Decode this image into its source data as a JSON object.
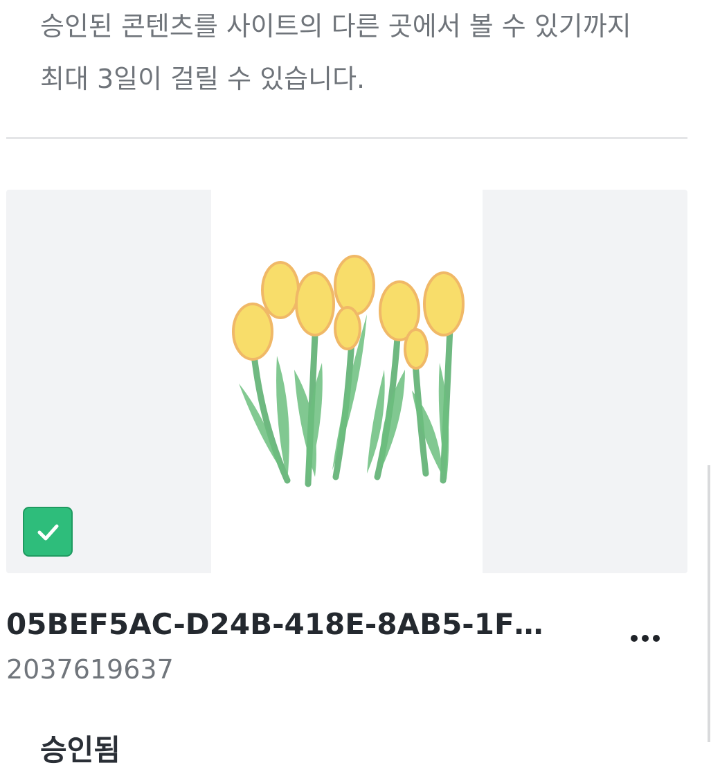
{
  "notice": {
    "line1": "승인된 콘텐츠를 사이트의 다른 곳에서 볼 수 있기까지",
    "line2": "최대 3일이 걸릴 수 있습니다."
  },
  "asset": {
    "title": "05BEF5AC-D24B-418E-8AB5-1FE9...",
    "id": "2037619637",
    "thumbnail_icon": "tulip-drawing-image",
    "selected": true,
    "more_icon": "more-horizontal-icon",
    "status": "승인됨"
  },
  "colors": {
    "accent_green": "#2ebd7b",
    "text_muted": "#6f747a",
    "text_dark": "#24292f"
  }
}
